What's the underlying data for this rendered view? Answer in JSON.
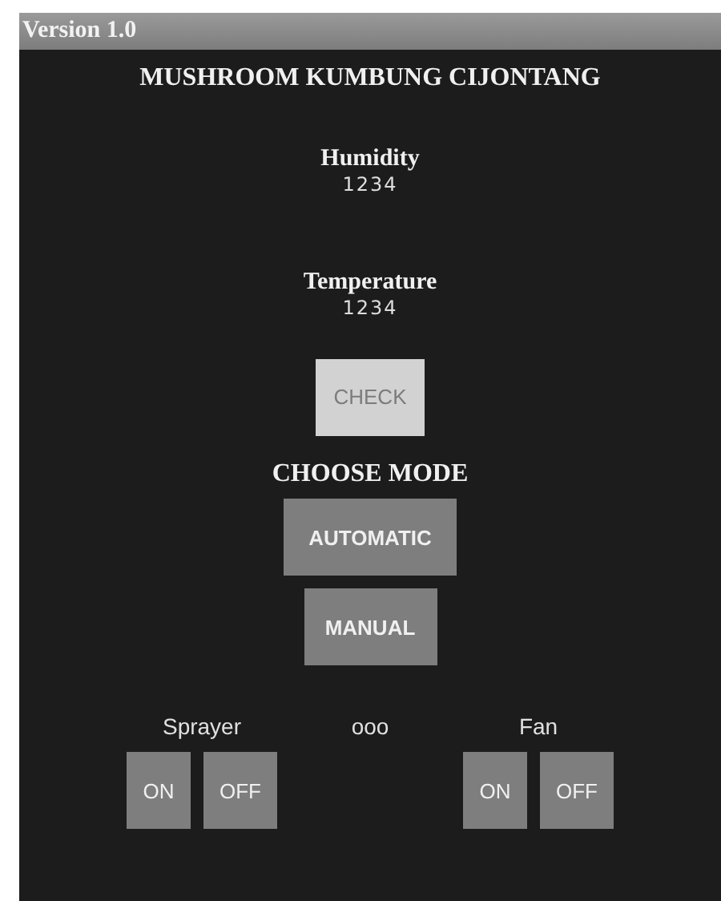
{
  "window": {
    "title": "Version 1.0"
  },
  "app_title": "MUSHROOM KUMBUNG CIJONTANG",
  "readings": [
    {
      "label": "Humidity",
      "value": "1234"
    },
    {
      "label": "Temperature",
      "value": "1234"
    }
  ],
  "check_button": {
    "label": "CHECK",
    "disabled": true
  },
  "mode": {
    "heading": "CHOOSE MODE",
    "buttons": [
      {
        "label": "AUTOMATIC"
      },
      {
        "label": "MANUAL"
      }
    ]
  },
  "devices": [
    {
      "name": "Sprayer",
      "buttons": [
        "ON",
        "OFF"
      ]
    },
    {
      "name": "Fan",
      "buttons": [
        "ON",
        "OFF"
      ]
    }
  ],
  "status": "ooo"
}
